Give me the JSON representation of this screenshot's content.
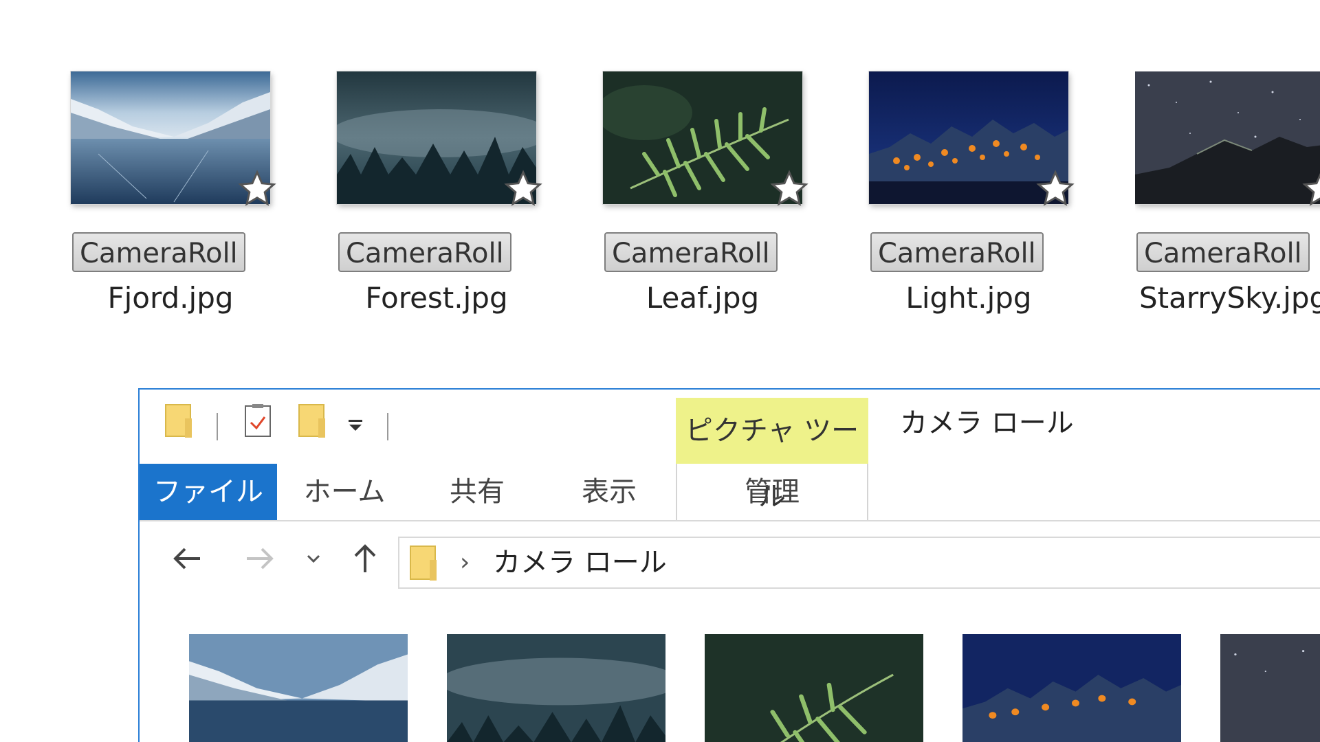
{
  "desktop_icons": [
    {
      "badge": "CameraRoll",
      "name": "Fjord.jpg"
    },
    {
      "badge": "CameraRoll",
      "name": "Forest.jpg"
    },
    {
      "badge": "CameraRoll",
      "name": "Leaf.jpg"
    },
    {
      "badge": "CameraRoll",
      "name": "Light.jpg"
    },
    {
      "badge": "CameraRoll",
      "name": "StarrySky.jpg"
    }
  ],
  "explorer": {
    "quick_access_icons": [
      "folder-icon",
      "properties-icon",
      "new-folder-icon",
      "customize-dropdown-icon"
    ],
    "context_tab_label": "ピクチャ ツール",
    "title": "カメラ ロール",
    "ribbon_tabs": {
      "file": "ファイル",
      "home": "ホーム",
      "share": "共有",
      "view": "表示",
      "manage": "管理"
    },
    "nav_icons": [
      "back-arrow-icon",
      "forward-arrow-icon",
      "recent-dropdown-icon",
      "up-arrow-icon"
    ],
    "address": {
      "separator": "›",
      "path": "カメラ ロール"
    }
  },
  "colors": {
    "accent": "#1b74cc",
    "window_border": "#2b7fd6",
    "context_tab": "#eef28a",
    "folder": "#f7d774"
  }
}
